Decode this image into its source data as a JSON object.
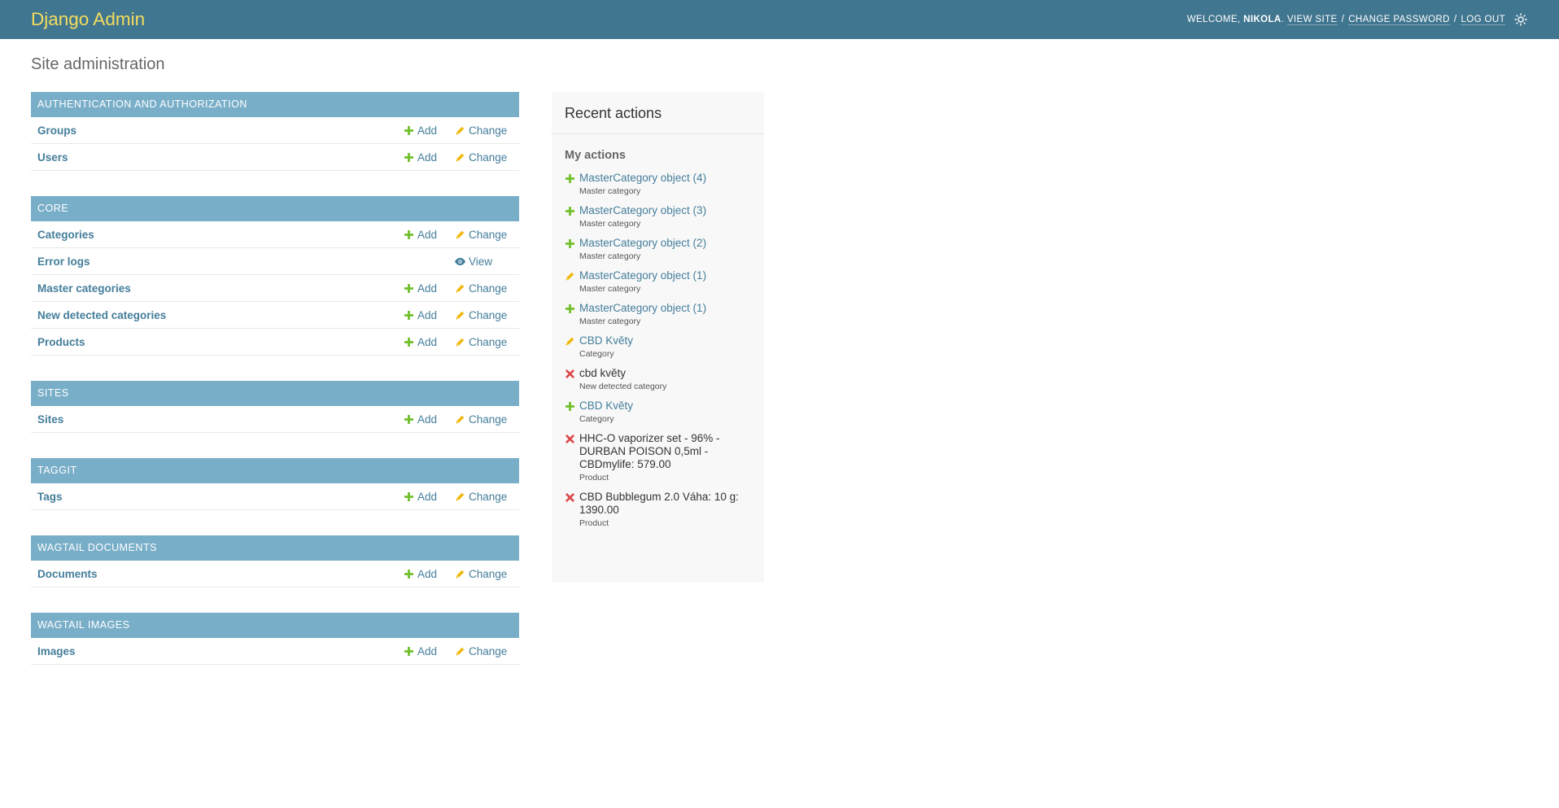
{
  "header": {
    "brand": "Django Admin",
    "welcome_prefix": "Welcome,",
    "username": "Nikola",
    "view_site": "View site",
    "change_password": "Change password",
    "log_out": "Log out",
    "separator": "/"
  },
  "page_title": "Site administration",
  "actions": {
    "add": "Add",
    "change": "Change",
    "view": "View"
  },
  "modules": [
    {
      "caption": "Authentication and Authorization",
      "models": [
        {
          "name": "Groups",
          "actions": [
            "add",
            "change"
          ]
        },
        {
          "name": "Users",
          "actions": [
            "add",
            "change"
          ]
        }
      ]
    },
    {
      "caption": "Core",
      "models": [
        {
          "name": "Categories",
          "actions": [
            "add",
            "change"
          ]
        },
        {
          "name": "Error logs",
          "actions": [
            "view"
          ]
        },
        {
          "name": "Master categories",
          "actions": [
            "add",
            "change"
          ]
        },
        {
          "name": "New detected categories",
          "actions": [
            "add",
            "change"
          ]
        },
        {
          "name": "Products",
          "actions": [
            "add",
            "change"
          ]
        }
      ]
    },
    {
      "caption": "Sites",
      "models": [
        {
          "name": "Sites",
          "actions": [
            "add",
            "change"
          ]
        }
      ]
    },
    {
      "caption": "Taggit",
      "models": [
        {
          "name": "Tags",
          "actions": [
            "add",
            "change"
          ]
        }
      ]
    },
    {
      "caption": "Wagtail Documents",
      "models": [
        {
          "name": "Documents",
          "actions": [
            "add",
            "change"
          ]
        }
      ]
    },
    {
      "caption": "Wagtail Images",
      "models": [
        {
          "name": "Images",
          "actions": [
            "add",
            "change"
          ]
        }
      ]
    }
  ],
  "recent_actions": {
    "title": "Recent actions",
    "subtitle": "My actions",
    "items": [
      {
        "action": "add",
        "label": "MasterCategory object (4)",
        "type": "Master category"
      },
      {
        "action": "add",
        "label": "MasterCategory object (3)",
        "type": "Master category"
      },
      {
        "action": "add",
        "label": "MasterCategory object (2)",
        "type": "Master category"
      },
      {
        "action": "change",
        "label": "MasterCategory object (1)",
        "type": "Master category"
      },
      {
        "action": "add",
        "label": "MasterCategory object (1)",
        "type": "Master category"
      },
      {
        "action": "change",
        "label": "CBD Květy",
        "type": "Category"
      },
      {
        "action": "delete",
        "label": "cbd květy",
        "type": "New detected category"
      },
      {
        "action": "add",
        "label": "CBD Květy",
        "type": "Category"
      },
      {
        "action": "delete",
        "label": "HHC-O vaporizer set - 96% - DURBAN POISON 0,5ml - CBDmylife: 579.00",
        "type": "Product"
      },
      {
        "action": "delete",
        "label": "CBD Bubblegum 2.0 Váha: 10 g: 1390.00",
        "type": "Product"
      }
    ]
  },
  "colors": {
    "header_bg": "#417690",
    "brand": "#f5dd5d",
    "module_caption_bg": "#79aec8",
    "link": "#447e9b",
    "add_icon": "#70bf2b",
    "change_icon": "#efb80b",
    "view_icon": "#447e9b",
    "delete_icon": "#dd4646"
  },
  "icons": {
    "add": "plus-icon",
    "change": "pencil-icon",
    "view": "eye-icon",
    "delete": "x-icon",
    "theme": "sun-icon"
  }
}
